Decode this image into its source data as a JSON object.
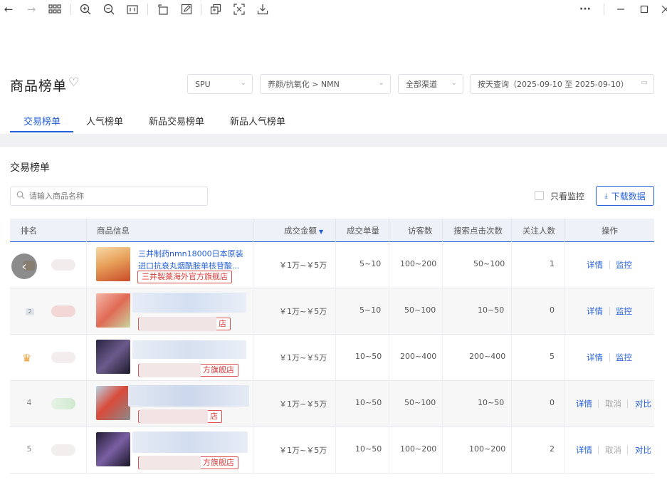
{
  "toolbar": {
    "icons": [
      "back-arrow-icon",
      "forward-arrow-icon",
      "grid-icon",
      "zoom-in-icon",
      "zoom-out-icon",
      "fit-icon",
      "rotate-icon",
      "edit-icon",
      "copy-icon",
      "crop-icon",
      "download-icon",
      "more-icon",
      "minimize-icon",
      "maximize-icon",
      "close-icon"
    ],
    "more": "···"
  },
  "header": {
    "title": "商品榜单",
    "filters": {
      "type": "SPU",
      "category": "养颜/抗氧化 > NMN",
      "channel": "全部渠道",
      "date": "按天查询（2025-09-10 至 2025-09-10）"
    }
  },
  "tabs": [
    "交易榜单",
    "人气榜单",
    "新品交易榜单",
    "新品人气榜单"
  ],
  "section": {
    "title": "交易榜单",
    "search_placeholder": "请输入商品名称",
    "monitor_only": "只看监控",
    "download": "下载数据"
  },
  "table": {
    "headers": [
      "排名",
      "商品信息",
      "成交金额",
      "成交单量",
      "访客数",
      "搜索点击次数",
      "关注人数",
      "操作"
    ],
    "rows": [
      {
        "rank": "",
        "name_line1": "三井制药nmn18000日本原装",
        "name_line2": "进口抗衰丸烟酰胺单核苷酸...",
        "store": "三井製薬海外官方旗舰店",
        "amount": "￥1万~￥5万",
        "orders": "5~10",
        "visitors": "100~200",
        "search_clicks": "50~100",
        "followers": "1",
        "actions": [
          "详情",
          "监控"
        ]
      },
      {
        "rank": "2",
        "name_line1": "",
        "name_line2": "",
        "store": "店",
        "amount": "￥1万~￥5万",
        "orders": "5~10",
        "visitors": "50~100",
        "search_clicks": "10~50",
        "followers": "0",
        "actions": [
          "详情",
          "监控"
        ]
      },
      {
        "rank": "",
        "name_line1": "",
        "name_line2": "",
        "store": "方旗舰店",
        "amount": "￥1万~￥5万",
        "orders": "10~50",
        "visitors": "200~400",
        "search_clicks": "200~400",
        "followers": "5",
        "actions": [
          "详情",
          "监控"
        ]
      },
      {
        "rank": "4",
        "name_line1": "",
        "name_line2": "",
        "store": "店",
        "amount": "￥1万~￥5万",
        "orders": "10~50",
        "visitors": "50~100",
        "search_clicks": "10~50",
        "followers": "0",
        "actions": [
          "详情",
          "取消",
          "对比"
        ]
      },
      {
        "rank": "5",
        "name_line1": "",
        "name_line2": "",
        "store": "方旗舰店",
        "amount": "￥1万~￥5万",
        "orders": "10~50",
        "visitors": "100~200",
        "search_clicks": "100~200",
        "followers": "2",
        "actions": [
          "详情",
          "取消",
          "对比"
        ]
      }
    ]
  },
  "colors": {
    "accent": "#2460d9",
    "store_tag": "#d83c3c",
    "header_bg": "#eef2f8"
  }
}
